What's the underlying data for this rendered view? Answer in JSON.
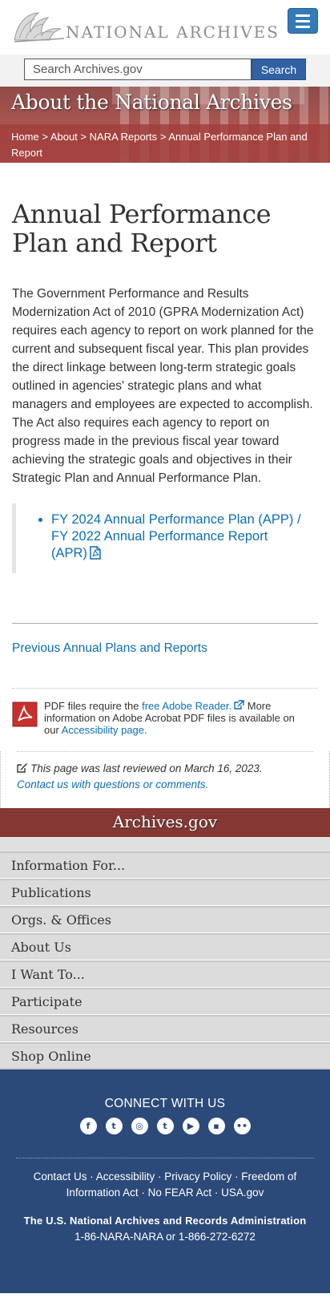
{
  "header": {
    "logo_text": "NATIONAL ARCHIVES",
    "menu_icon": "hamburger-menu-icon"
  },
  "search": {
    "placeholder": "Search Archives.gov",
    "button_label": "Search"
  },
  "banner": {
    "title": "About the National Archives",
    "breadcrumb": {
      "home": "Home",
      "about": "About",
      "reports": "NARA Reports",
      "current": "Annual Performance Plan and Report",
      "separator": ">"
    }
  },
  "main": {
    "title": "Annual Performance Plan and Report",
    "intro": "The Government Performance and Results Modernization Act of 2010 (GPRA Modernization Act) requires each agency to report on work planned for the current and subsequent fiscal year.  This plan provides the direct linkage between long-term strategic goals outlined in agencies' strategic plans and what managers and employees are expected to accomplish. The Act also requires each agency to report on progress made in the previous fiscal year toward achieving the strategic goals and objectives in their Strategic Plan and Annual Performance Plan.",
    "doc_link": "FY 2024 Annual Performance Plan (APP) / FY 2022 Annual Performance Report (APR)",
    "prev_link": "Previous Annual Plans and Reports",
    "pdf_note": {
      "prefix": "PDF files require the ",
      "reader_link": "free Adobe Reader.",
      "middle": " More information on Adobe Acrobat PDF files is available on our ",
      "access_link": "Accessibility page",
      "suffix": "."
    },
    "reviewed": "This page was last reviewed on March 16, 2023.",
    "contact": "Contact us with questions or comments."
  },
  "footer": {
    "archives_title": "Archives.gov",
    "nav": [
      "Information For...",
      "Publications",
      "Orgs. & Offices",
      "About Us",
      "I Want To...",
      "Participate",
      "Resources",
      "Shop Online"
    ],
    "connect": "CONNECT WITH US",
    "social": [
      {
        "name": "facebook-icon",
        "glyph": "f"
      },
      {
        "name": "twitter-icon",
        "glyph": "t"
      },
      {
        "name": "instagram-icon",
        "glyph": "◎"
      },
      {
        "name": "tumblr-icon",
        "glyph": "t"
      },
      {
        "name": "youtube-icon",
        "glyph": "▶"
      },
      {
        "name": "blog-icon",
        "glyph": "▪"
      },
      {
        "name": "flickr-icon",
        "glyph": "••"
      }
    ],
    "links": [
      "Contact Us",
      "Accessibility",
      "Privacy Policy",
      "Freedom of Information Act",
      "No FEAR Act",
      "USA.gov"
    ],
    "link_separator": " · ",
    "org_name": "The U.S. National Archives and Records Administration",
    "phone": "1-86-NARA-NARA or 1-866-272-6272"
  },
  "colors": {
    "link": "#0d6eb3",
    "banner": "#a85450",
    "archives_bar": "#853733",
    "footer_blue": "#2c4a79",
    "search_button": "#3161a3"
  }
}
